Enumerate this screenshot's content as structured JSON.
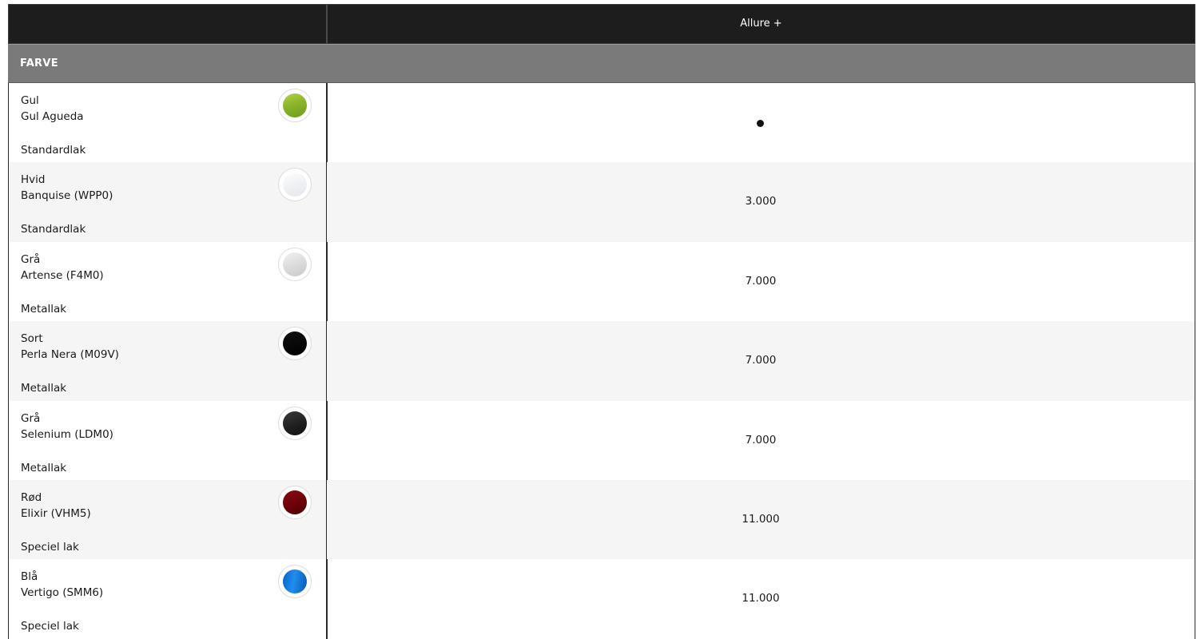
{
  "header": {
    "column_title": "Allure +"
  },
  "section": {
    "title": "FARVE"
  },
  "rows": [
    {
      "name": "Gul",
      "paint": "Gul Agueda",
      "type": "Standardlak",
      "price": "",
      "standard": true,
      "swatch": "linear-gradient(160deg,#b5d34a 0%,#8bb52a 45%,#6f9a1f 100%)"
    },
    {
      "name": "Hvid",
      "paint": "Banquise (WPP0)",
      "type": "Standardlak",
      "price": "3.000",
      "standard": false,
      "swatch": "linear-gradient(160deg,#ffffff 0%,#f0f1f4 50%,#e4e6ea 100%)"
    },
    {
      "name": "Grå",
      "paint": "Artense (F4M0)",
      "type": "Metallak",
      "price": "7.000",
      "standard": false,
      "swatch": "linear-gradient(160deg,#f2f2f2 0%,#dcdcdc 50%,#c9c9c9 100%)"
    },
    {
      "name": "Sort",
      "paint": "Perla Nera (M09V)",
      "type": "Metallak",
      "price": "7.000",
      "standard": false,
      "swatch": "linear-gradient(160deg,#111111 0%,#000000 100%)"
    },
    {
      "name": "Grå",
      "paint": "Selenium (LDM0)",
      "type": "Metallak",
      "price": "7.000",
      "standard": false,
      "swatch": "linear-gradient(160deg,#3a3a3a 0%,#1e1e1e 60%,#121212 100%)"
    },
    {
      "name": "Rød",
      "paint": "Elixir (VHM5)",
      "type": "Speciel lak",
      "price": "11.000",
      "standard": false,
      "swatch": "linear-gradient(160deg,#8a0a12 0%,#6a0008 60%,#4a0006 100%)"
    },
    {
      "name": "Blå",
      "paint": "Vertigo (SMM6)",
      "type": "Speciel lak",
      "price": "11.000",
      "standard": false,
      "swatch": "linear-gradient(100deg,#0a5fc4 0%,#1f8ef0 45%,#0b57b8 100%)"
    }
  ]
}
